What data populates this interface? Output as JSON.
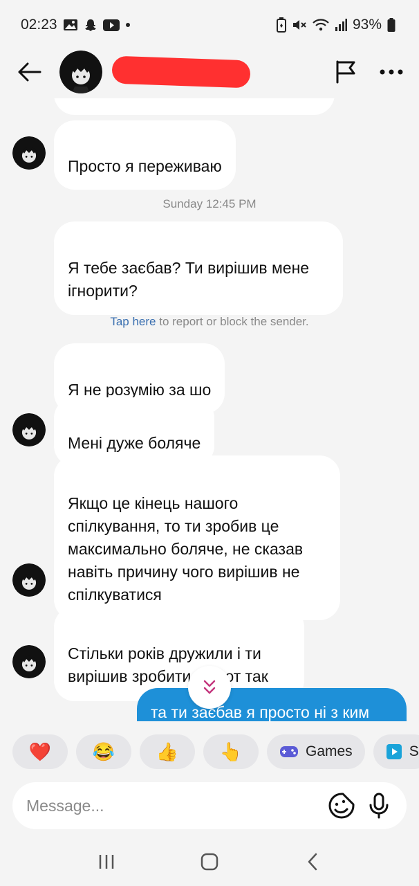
{
  "status_bar": {
    "time": "02:23",
    "battery": "93%",
    "left_icons": [
      "gallery-icon",
      "snapchat-icon",
      "youtube-icon",
      "dot-icon"
    ],
    "right_icons": [
      "battery-saver-icon",
      "mute-icon",
      "wifi-icon",
      "signal-icon",
      "battery-icon"
    ]
  },
  "header": {
    "contact_name_redacted": true,
    "icons": [
      "back-arrow-icon",
      "flag-icon",
      "more-icon"
    ]
  },
  "conversation": {
    "messages_top": [
      {
        "text": "Просто я переживаю"
      }
    ],
    "timestamp": "Sunday 12:45 PM",
    "messages_mid": [
      {
        "text": "Я тебе заєбав? Ти вирішив мене\nігнорити?"
      }
    ],
    "report": {
      "link_text": "Tap here",
      "rest_text": " to report or block the sender."
    },
    "messages_bottom": [
      {
        "text": "Я не розумію за шо"
      },
      {
        "text": "Мені дуже боляче"
      },
      {
        "text": "Якщо це кінець нашого\nспілкування, то ти зробив це\nмаксимально боляче, не сказав\nнавіть причину чого вирішив не\nспілкуватися"
      },
      {
        "text": "Стільки років дружили і ти\nвирішив зробити все от так"
      }
    ],
    "outgoing": {
      "text": "та ти заєбав я просто ні з ким"
    }
  },
  "quick_replies": [
    {
      "emoji": "❤️",
      "label": ""
    },
    {
      "emoji": "😂",
      "label": ""
    },
    {
      "emoji": "👍",
      "label": ""
    },
    {
      "emoji": "👆",
      "label": ""
    },
    {
      "emoji": "",
      "label": "Games"
    },
    {
      "emoji": "",
      "label": "S"
    }
  ],
  "composer": {
    "placeholder": "Message..."
  },
  "colors": {
    "background": "#f4f4f4",
    "incoming_bubble": "#ffffff",
    "outgoing_bubble": "#1e90d8",
    "link": "#3a6fb0",
    "redaction": "#ff3030"
  }
}
